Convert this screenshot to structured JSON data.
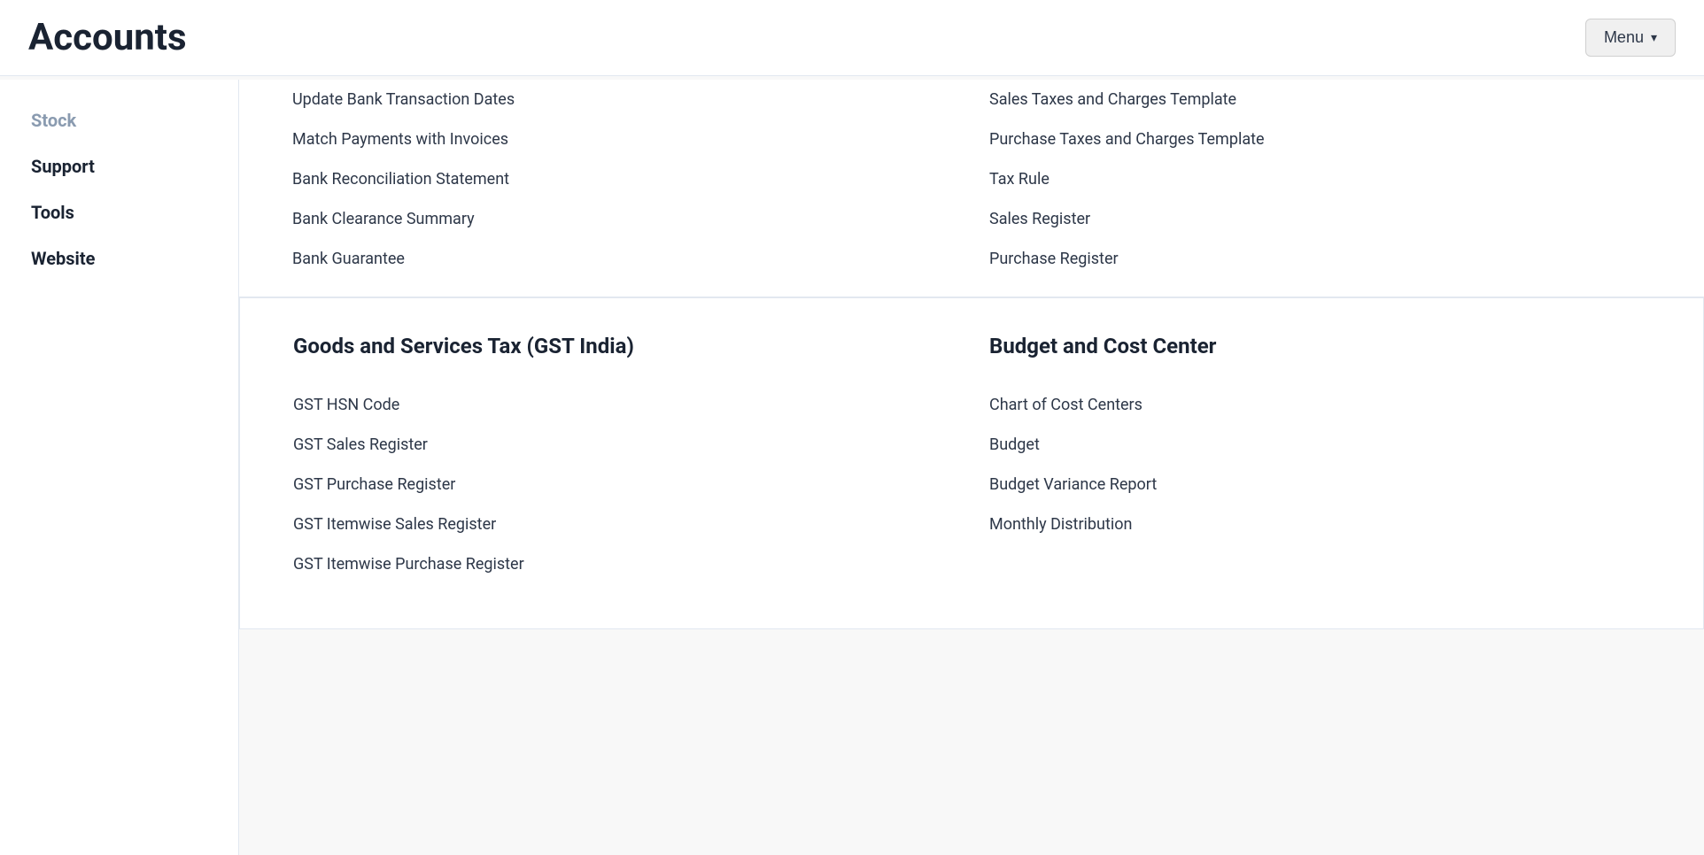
{
  "header": {
    "title": "Accounts",
    "menu_label": "Menu"
  },
  "sidebar": {
    "items": [
      {
        "label": "Stock",
        "faded": true
      },
      {
        "label": "Support",
        "faded": false
      },
      {
        "label": "Tools",
        "faded": false
      },
      {
        "label": "Website",
        "faded": false
      }
    ]
  },
  "top_partial": {
    "left_links": [
      "Update Bank Transaction Dates",
      "Match Payments with Invoices",
      "Bank Reconciliation Statement",
      "Bank Clearance Summary",
      "Bank Guarantee"
    ],
    "right_links": [
      "Sales Taxes and Charges Template",
      "Purchase Taxes and Charges Template",
      "Tax Rule",
      "Sales Register",
      "Purchase Register"
    ]
  },
  "sections": [
    {
      "left": {
        "heading": "Goods and Services Tax (GST India)",
        "links": [
          "GST HSN Code",
          "GST Sales Register",
          "GST Purchase Register",
          "GST Itemwise Sales Register",
          "GST Itemwise Purchase Register"
        ]
      },
      "right": {
        "heading": "Budget and Cost Center",
        "links": [
          "Chart of Cost Centers",
          "Budget",
          "Budget Variance Report",
          "Monthly Distribution"
        ]
      }
    }
  ]
}
